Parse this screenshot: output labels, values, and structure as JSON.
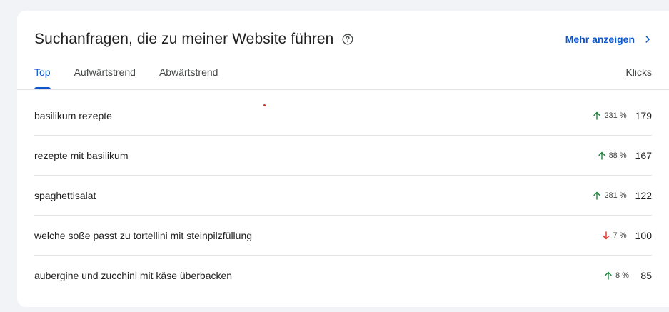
{
  "card": {
    "title": "Suchanfragen, die zu meiner Website führen",
    "help_icon": "help-circle-icon",
    "more_label": "Mehr anzeigen",
    "more_icon": "chevron-right-icon"
  },
  "tabs": [
    {
      "label": "Top",
      "active": true
    },
    {
      "label": "Aufwärtstrend",
      "active": false
    },
    {
      "label": "Abwärtstrend",
      "active": false
    }
  ],
  "column_header": "Klicks",
  "rows": [
    {
      "query": "basilikum rezepte",
      "direction": "up",
      "change": "231 %",
      "clicks": "179"
    },
    {
      "query": "rezepte mit basilikum",
      "direction": "up",
      "change": "88 %",
      "clicks": "167"
    },
    {
      "query": "spaghettisalat",
      "direction": "up",
      "change": "281 %",
      "clicks": "122"
    },
    {
      "query": "welche soße passt zu tortellini mit steinpilzfüllung",
      "direction": "down",
      "change": "7 %",
      "clicks": "100"
    },
    {
      "query": "aubergine und zucchini mit käse überbacken",
      "direction": "up",
      "change": "8 %",
      "clicks": "85"
    }
  ],
  "colors": {
    "accent": "#0b57d0",
    "trend_up": "#188038",
    "trend_down": "#d93025"
  }
}
